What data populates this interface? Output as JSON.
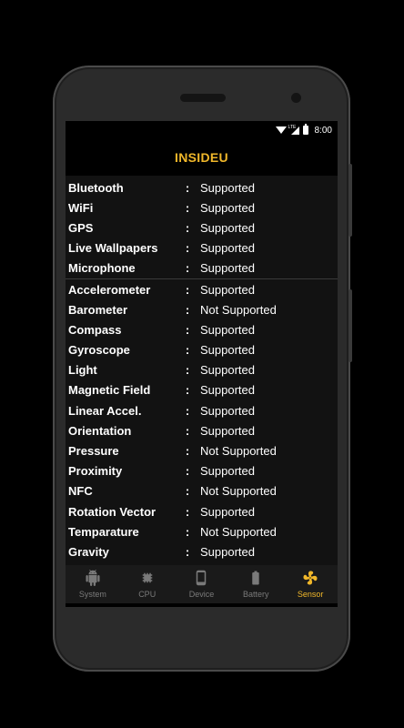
{
  "status_bar": {
    "time": "8:00",
    "network": "LTE"
  },
  "app": {
    "title": "INSIDEU"
  },
  "separator": ":",
  "group1": [
    {
      "name": "Bluetooth",
      "value": "Supported"
    },
    {
      "name": "WiFi",
      "value": "Supported"
    },
    {
      "name": "GPS",
      "value": "Supported"
    },
    {
      "name": "Live Wallpapers",
      "value": "Supported"
    },
    {
      "name": "Microphone",
      "value": "Supported"
    }
  ],
  "group2": [
    {
      "name": "Accelerometer",
      "value": "Supported"
    },
    {
      "name": "Barometer",
      "value": "Not Supported"
    },
    {
      "name": "Compass",
      "value": "Supported"
    },
    {
      "name": "Gyroscope",
      "value": "Supported"
    },
    {
      "name": "Light",
      "value": "Supported"
    },
    {
      "name": "Magnetic Field",
      "value": "Supported"
    },
    {
      "name": "Linear Accel.",
      "value": "Supported"
    },
    {
      "name": "Orientation",
      "value": "Supported"
    },
    {
      "name": "Pressure",
      "value": "Not Supported"
    },
    {
      "name": "Proximity",
      "value": "Supported"
    },
    {
      "name": "NFC",
      "value": "Not Supported"
    },
    {
      "name": "Rotation Vector",
      "value": "Supported"
    },
    {
      "name": "Temparature",
      "value": "Not Supported"
    },
    {
      "name": "Gravity",
      "value": "Supported"
    }
  ],
  "tabs": [
    {
      "label": "System",
      "icon": "android-icon",
      "active": false
    },
    {
      "label": "CPU",
      "icon": "cpu-chip-icon",
      "active": false
    },
    {
      "label": "Device",
      "icon": "phone-device-icon",
      "active": false
    },
    {
      "label": "Battery",
      "icon": "battery-icon",
      "active": false
    },
    {
      "label": "Sensor",
      "icon": "fan-sensor-icon",
      "active": true
    }
  ],
  "colors": {
    "accent": "#f0b72a",
    "inactive": "#7a7a7a",
    "list_bg": "#121212"
  }
}
